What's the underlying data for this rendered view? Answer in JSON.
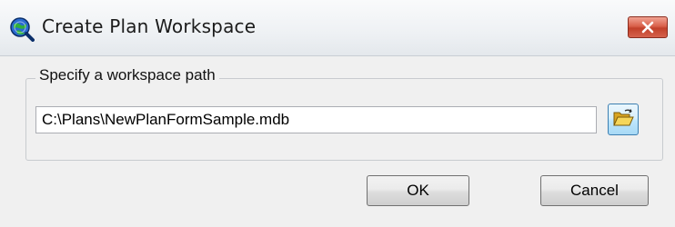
{
  "window": {
    "title": "Create Plan Workspace",
    "icon": "globe-magnifier-icon",
    "close_icon": "close-icon"
  },
  "group": {
    "label": "Specify a workspace path"
  },
  "path_input": {
    "value": "C:\\Plans\\NewPlanFormSample.mdb",
    "placeholder": ""
  },
  "browse": {
    "icon": "open-folder-icon"
  },
  "buttons": {
    "ok_label": "OK",
    "cancel_label": "Cancel"
  },
  "colors": {
    "close_button": "#c94a34",
    "browse_button_border": "#3c7fb1",
    "dialog_background": "#f0f0f0"
  }
}
